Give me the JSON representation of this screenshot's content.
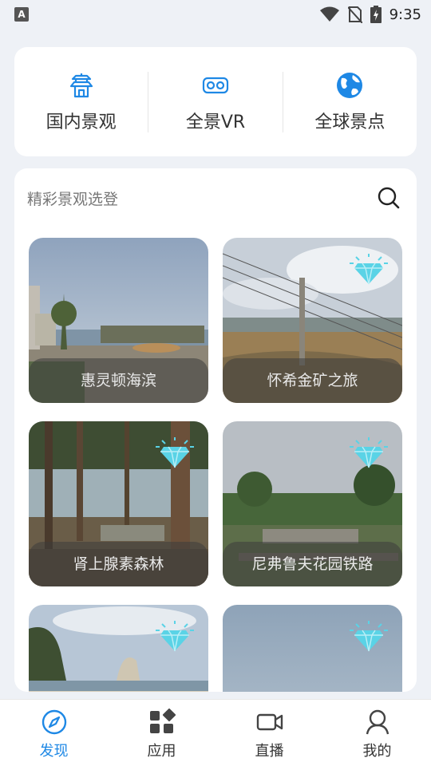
{
  "status_bar": {
    "time": "9:35",
    "app_icon_letter": "A"
  },
  "categories": [
    {
      "label": "国内景观",
      "icon": "pagoda-icon"
    },
    {
      "label": "全景VR",
      "icon": "vr-goggles-icon"
    },
    {
      "label": "全球景点",
      "icon": "globe-icon"
    }
  ],
  "section": {
    "title": "精彩景观选登",
    "search_icon": "search-icon"
  },
  "tiles": [
    {
      "caption": "惠灵顿海滨",
      "scene": "waterfront"
    },
    {
      "caption": "怀希金矿之旅",
      "scene": "goldmine",
      "badge": "diamond-icon"
    },
    {
      "caption": "肾上腺素森林",
      "scene": "forest",
      "badge": "diamond-icon"
    },
    {
      "caption": "尼弗鲁夫花园铁路",
      "scene": "garden",
      "badge": "diamond-icon"
    },
    {
      "caption": "",
      "scene": "beach",
      "badge": "diamond-icon"
    },
    {
      "caption": "",
      "scene": "sky",
      "badge": "diamond-icon"
    }
  ],
  "nav": [
    {
      "label": "发现",
      "icon": "compass-icon",
      "active": true
    },
    {
      "label": "应用",
      "icon": "apps-icon",
      "active": false
    },
    {
      "label": "直播",
      "icon": "video-camera-icon",
      "active": false
    },
    {
      "label": "我的",
      "icon": "user-icon",
      "active": false
    }
  ],
  "colors": {
    "accent": "#1e88e5",
    "diamond": "#5ad3e6",
    "background": "#eef1f6"
  }
}
